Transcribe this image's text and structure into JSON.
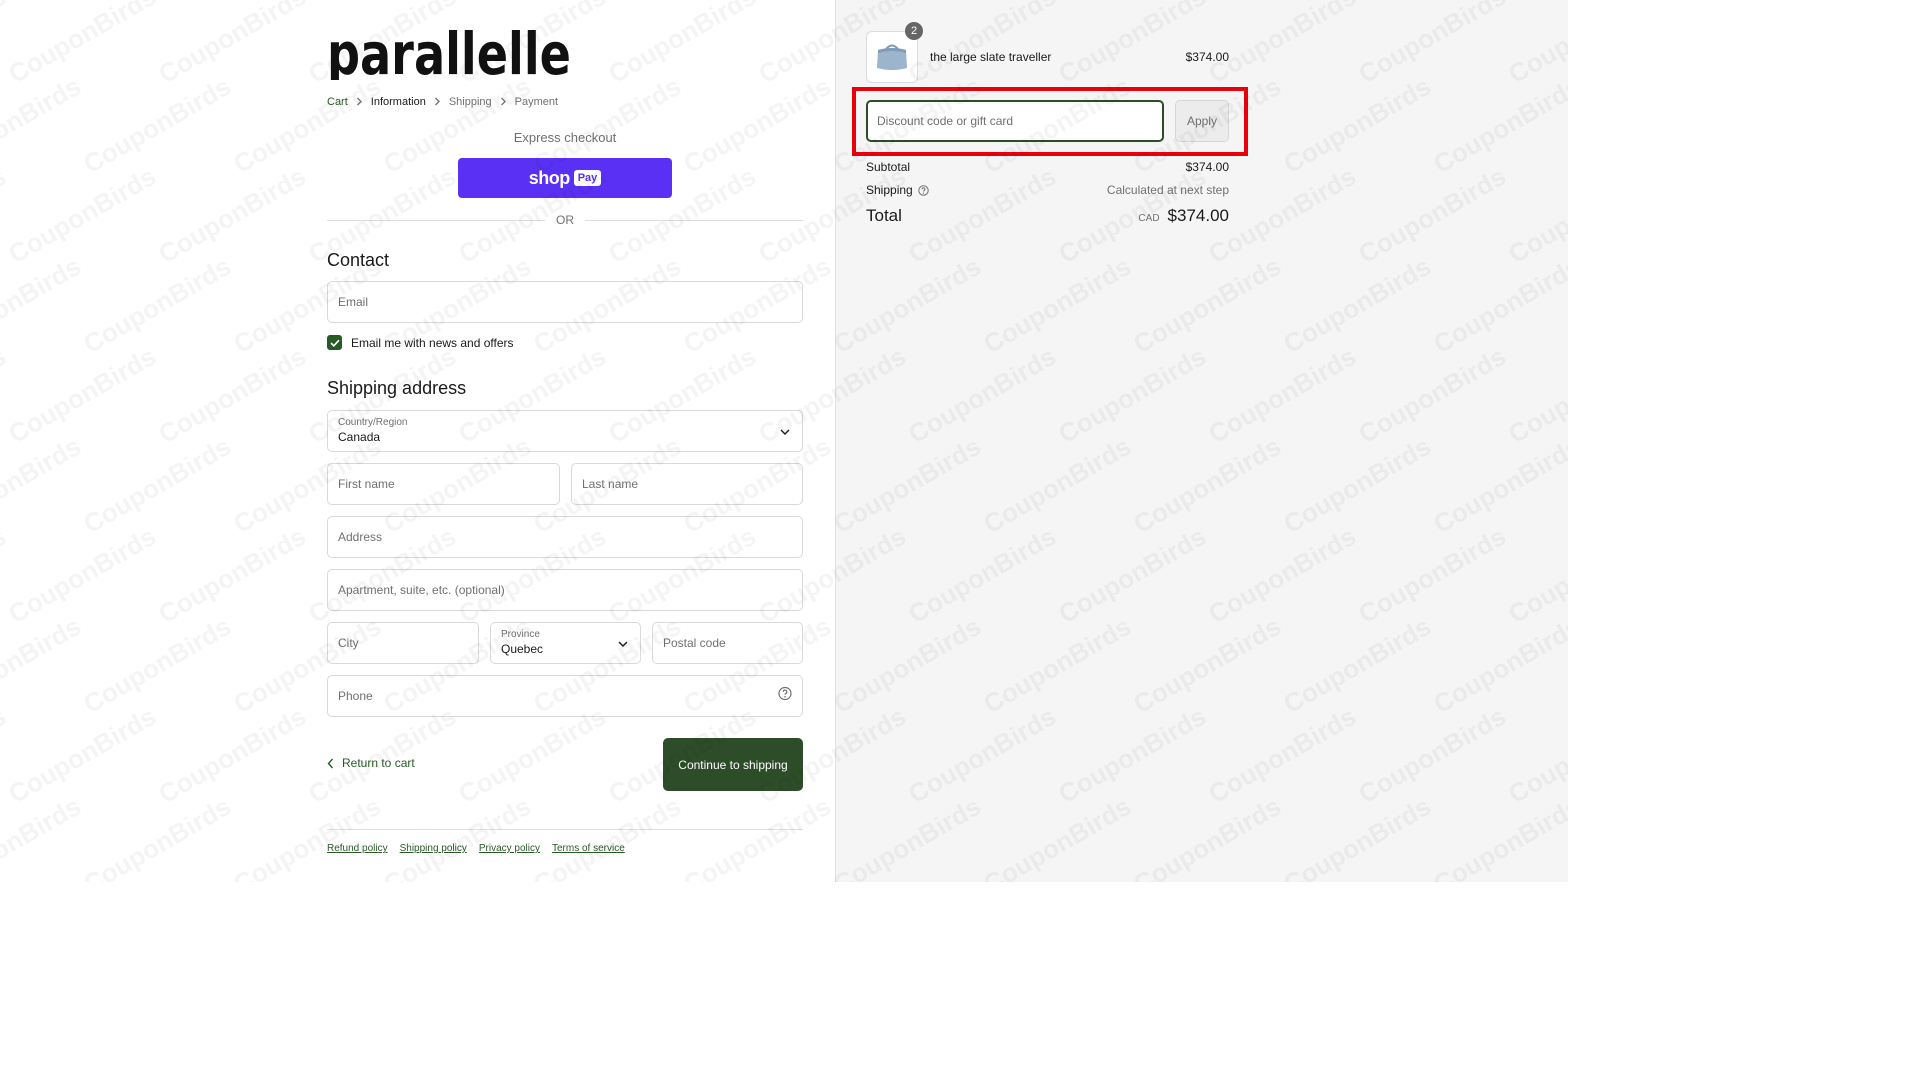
{
  "brand": {
    "logo_text": "parallelle"
  },
  "breadcrumb": [
    {
      "label": "Cart",
      "state": "link"
    },
    {
      "label": "Information",
      "state": "current"
    },
    {
      "label": "Shipping",
      "state": "upcoming"
    },
    {
      "label": "Payment",
      "state": "upcoming"
    }
  ],
  "express": {
    "title": "Express checkout",
    "shop_pay_text": "shop",
    "shop_pay_badge": "Pay",
    "or_label": "OR"
  },
  "contact": {
    "heading": "Contact",
    "email_placeholder": "Email",
    "newsletter_label": "Email me with news and offers",
    "newsletter_checked": true
  },
  "shipping": {
    "heading": "Shipping address",
    "country_label": "Country/Region",
    "country_value": "Canada",
    "first_name_placeholder": "First name",
    "last_name_placeholder": "Last name",
    "address_placeholder": "Address",
    "apartment_placeholder": "Apartment, suite, etc. (optional)",
    "city_placeholder": "City",
    "province_label": "Province",
    "province_value": "Quebec",
    "postal_placeholder": "Postal code",
    "phone_placeholder": "Phone"
  },
  "actions": {
    "return_label": "Return to cart",
    "continue_label": "Continue to shipping"
  },
  "footer": {
    "links": [
      "Refund policy",
      "Shipping policy",
      "Privacy policy",
      "Terms of service"
    ]
  },
  "summary": {
    "item": {
      "name": "the large slate traveller",
      "price": "$374.00",
      "quantity": "2"
    },
    "discount_placeholder": "Discount code or gift card",
    "apply_label": "Apply",
    "subtotal_label": "Subtotal",
    "subtotal_value": "$374.00",
    "shipping_label": "Shipping",
    "shipping_value": "Calculated at next step",
    "total_label": "Total",
    "currency": "CAD",
    "total_value": "$374.00"
  },
  "watermark": "CouponBirds",
  "colors": {
    "accent": "#2c4d28",
    "link": "#285a26",
    "shop_pay": "#5a31f4",
    "highlight": "#e8000b"
  }
}
